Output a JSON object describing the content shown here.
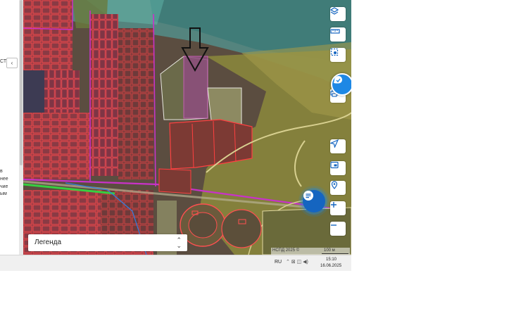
{
  "side_panel": {
    "fragment_top": "СТ",
    "collapse_glyph": "‹",
    "fragment_1": "в",
    "fragment_2": "нее",
    "fragment_3": "чие",
    "fragment_4": "ым"
  },
  "legend": {
    "label": "Легенда",
    "chevron_up": "⌃",
    "chevron_down": "⌄"
  },
  "attribution": {
    "text": "НСПД 2025 ©",
    "scale": "100 м"
  },
  "taskbar": {
    "language": "RU",
    "tray": "⌃ ⊠ ◫ ◀)",
    "time": "15:10",
    "date": "16.06.2025"
  },
  "map_controls": [
    "layers-icon",
    "ruler-icon",
    "select-area-icon",
    "print-icon",
    "navigate-icon",
    "image-icon",
    "location-icon",
    "zoom-in-icon",
    "zoom-out-icon"
  ],
  "colors": {
    "accent": "#1e88e5",
    "parcel_outline": "#ff3b3b",
    "boundary": "#c832c8"
  }
}
